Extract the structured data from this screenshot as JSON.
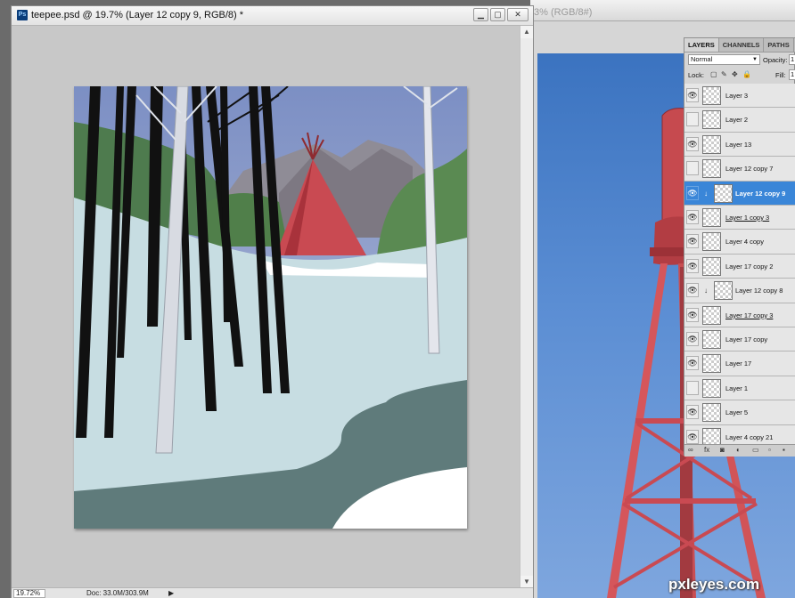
{
  "doc_front": {
    "app_icon": "Ps",
    "title": "teepee.psd @ 19.7% (Layer 12 copy 9, RGB/8) *",
    "zoom": "19.72%",
    "doc_info": "Doc: 33.0M/303.9M",
    "minimize_icon": "minimize-icon",
    "maximize_icon": "maximize-icon",
    "close_icon": "close-icon"
  },
  "doc_back": {
    "title_fragment": "3% (RGB/8#)"
  },
  "layers_panel": {
    "tabs": [
      "LAYERS",
      "CHANNELS",
      "PATHS"
    ],
    "active_tab": "LAYERS",
    "blend_mode": "Normal",
    "opacity_label": "Opacity:",
    "opacity_value": "1",
    "lock_label": "Lock:",
    "fill_label": "Fill:",
    "fill_value": "1",
    "layers": [
      {
        "name": "Layer 3",
        "visible": true,
        "selected": false,
        "clipped": false,
        "underline": false
      },
      {
        "name": "Layer 2",
        "visible": false,
        "selected": false,
        "clipped": false,
        "underline": false
      },
      {
        "name": "Layer 13",
        "visible": true,
        "selected": false,
        "clipped": false,
        "underline": false
      },
      {
        "name": "Layer 12 copy 7",
        "visible": false,
        "selected": false,
        "clipped": false,
        "underline": false
      },
      {
        "name": "Layer 12 copy 9",
        "visible": true,
        "selected": true,
        "clipped": true,
        "underline": false
      },
      {
        "name": "Layer 1 copy 3",
        "visible": true,
        "selected": false,
        "clipped": false,
        "underline": true
      },
      {
        "name": "Layer 4 copy",
        "visible": true,
        "selected": false,
        "clipped": false,
        "underline": false
      },
      {
        "name": "Layer 17 copy 2",
        "visible": true,
        "selected": false,
        "clipped": false,
        "underline": false
      },
      {
        "name": "Layer 12 copy 8",
        "visible": true,
        "selected": false,
        "clipped": true,
        "underline": false
      },
      {
        "name": "Layer 17 copy 3",
        "visible": true,
        "selected": false,
        "clipped": false,
        "underline": true
      },
      {
        "name": "Layer 17 copy",
        "visible": true,
        "selected": false,
        "clipped": false,
        "underline": false
      },
      {
        "name": "Layer 17",
        "visible": true,
        "selected": false,
        "clipped": false,
        "underline": false
      },
      {
        "name": "Layer 1",
        "visible": false,
        "selected": false,
        "clipped": false,
        "underline": false
      },
      {
        "name": "Layer 5",
        "visible": true,
        "selected": false,
        "clipped": false,
        "underline": false
      },
      {
        "name": "Layer 4 copy 21",
        "visible": true,
        "selected": false,
        "clipped": false,
        "underline": false
      }
    ],
    "footer_icons": [
      "link-icon",
      "fx-icon",
      "mask-icon",
      "adjustment-icon",
      "folder-icon",
      "new-layer-icon",
      "trash-icon"
    ]
  },
  "credit": "pxleyes.com",
  "colors": {
    "selection_blue": "#3a86d8",
    "sky_blue": "#4a7fc8",
    "teepee_red": "#c94a52",
    "snow": "#c7dde2",
    "water": "#5f7b7b"
  }
}
